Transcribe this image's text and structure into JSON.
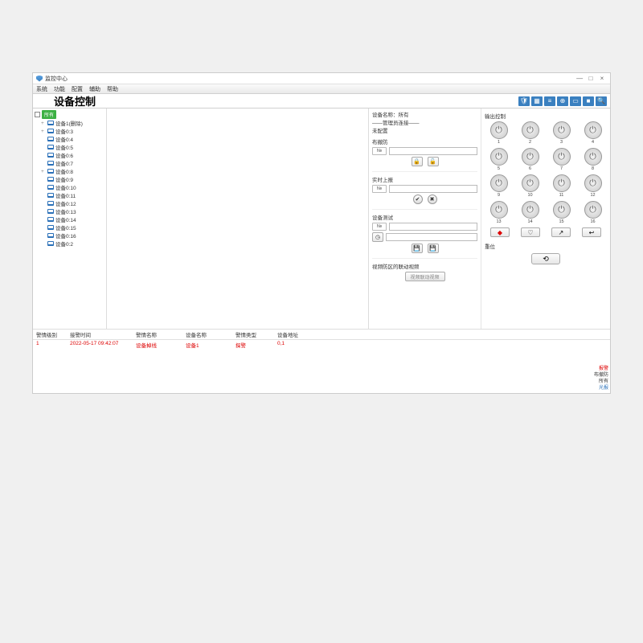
{
  "window": {
    "title": "监控中心",
    "minimize": "—",
    "maximize": "□",
    "close": "×"
  },
  "menu": [
    "系统",
    "功能",
    "配置",
    "辅助",
    "帮助"
  ],
  "page_title": "设备控制",
  "toolbar_icons": [
    "shield",
    "grid",
    "list",
    "globe",
    "card",
    "video",
    "search"
  ],
  "tree": {
    "root": "所有",
    "items": [
      {
        "label": "设备1(删除)",
        "exp": "+"
      },
      {
        "label": "设备0:3",
        "exp": "+"
      },
      {
        "label": "设备0:4",
        "exp": ""
      },
      {
        "label": "设备0:5",
        "exp": ""
      },
      {
        "label": "设备0:6",
        "exp": ""
      },
      {
        "label": "设备0:7",
        "exp": ""
      },
      {
        "label": "设备0:8",
        "exp": "+"
      },
      {
        "label": "设备0:9",
        "exp": ""
      },
      {
        "label": "设备0:10",
        "exp": ""
      },
      {
        "label": "设备0:11",
        "exp": ""
      },
      {
        "label": "设备0:12",
        "exp": ""
      },
      {
        "label": "设备0:13",
        "exp": ""
      },
      {
        "label": "设备0:14",
        "exp": ""
      },
      {
        "label": "设备0:15",
        "exp": ""
      },
      {
        "label": "设备0:16",
        "exp": ""
      },
      {
        "label": "设备0:2",
        "exp": ""
      }
    ]
  },
  "info": {
    "name_label": "设备名称：",
    "name_value": "所有",
    "conn_label": "——管理员连接——",
    "conn_value": "未配置"
  },
  "sections": {
    "arm": "布撤防",
    "bypass": "实时上报",
    "mode": "设备测试",
    "link": "视频防区的联动视频",
    "link_btn": "视频联动视频",
    "output": "输出控制",
    "reset": "重位"
  },
  "power": {
    "count": 16
  },
  "nav_icons": [
    "◆",
    "♡",
    "↗",
    "↩"
  ],
  "table": {
    "headers": [
      "警情级别",
      "接警时间",
      "警情名称",
      "设备名称",
      "警情类型",
      "设备地址"
    ],
    "row": [
      "1",
      "2022-05-17 09:42:07",
      "设备掉线",
      "设备1",
      "探警",
      "0,1"
    ]
  },
  "legend": [
    "报警",
    "布撤防",
    "所有",
    "光报"
  ]
}
